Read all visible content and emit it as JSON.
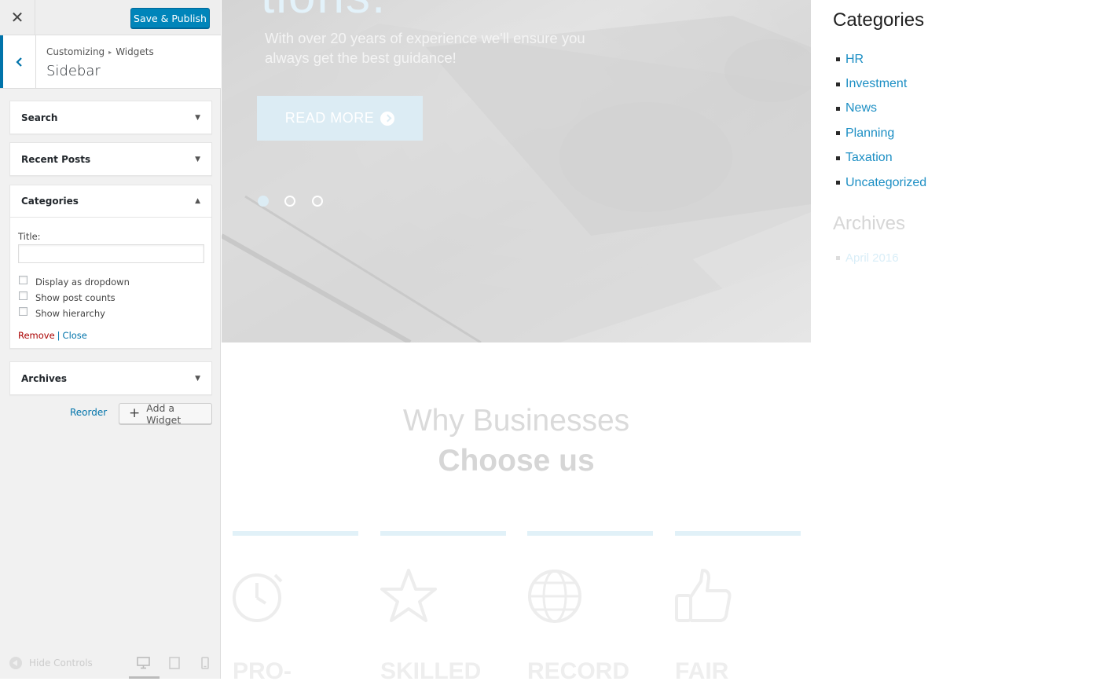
{
  "customizer": {
    "save_publish_label": "Save & Publish",
    "breadcrumb": [
      "Customizing",
      "Widgets"
    ],
    "breadcrumb_separator": "▸",
    "section_title": "Sidebar",
    "widgets": [
      {
        "title": "Search",
        "expanded": false
      },
      {
        "title": "Recent Posts",
        "expanded": false
      },
      {
        "title": "Categories",
        "expanded": true
      },
      {
        "title": "Archives",
        "expanded": false
      }
    ],
    "categories_form": {
      "title_label": "Title:",
      "title_value": "",
      "options": [
        {
          "label": "Display as dropdown",
          "checked": false
        },
        {
          "label": "Show post counts",
          "checked": false
        },
        {
          "label": "Show hierarchy",
          "checked": false
        }
      ],
      "remove_label": "Remove",
      "separator": "|",
      "close_label": "Close"
    },
    "reorder_label": "Reorder",
    "add_widget_label": "Add a Widget",
    "hide_controls_label": "Hide Controls",
    "accent_color": "#0085ba",
    "remove_color": "#aa0000"
  },
  "preview": {
    "hero": {
      "heading": "tions.",
      "text": "With over 20 years of experience we'll ensure you always get the best guidance!",
      "button_label": "READ MORE",
      "slide_count": 3,
      "active_slide": 1
    },
    "why": {
      "line1": "Why Businesses",
      "line2": "Choose us"
    },
    "features": [
      {
        "icon": "stopwatch-icon",
        "label": "PRO-"
      },
      {
        "icon": "star-icon",
        "label": "SKILLED"
      },
      {
        "icon": "globe-icon",
        "label": "RECORD"
      },
      {
        "icon": "thumbs-up-icon",
        "label": "FAIR"
      }
    ],
    "sidebar": {
      "categories_title": "Categories",
      "categories": [
        "HR",
        "Investment",
        "News",
        "Planning",
        "Taxation",
        "Uncategorized"
      ],
      "archives_title": "Archives",
      "archives": [
        "April 2016"
      ],
      "link_color": "#1d8fc4"
    }
  }
}
